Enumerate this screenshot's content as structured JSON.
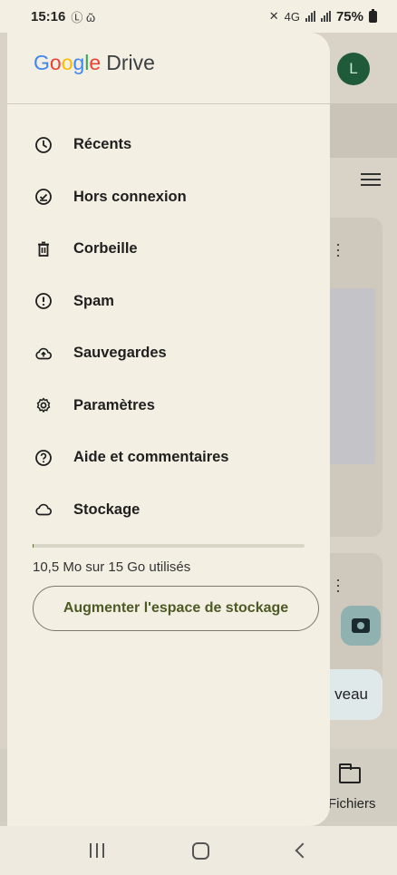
{
  "status_bar": {
    "time": "15:16",
    "indicators_left": "Ⓛ ῶ",
    "network": "4G",
    "battery": "75%"
  },
  "app": {
    "logo_google": [
      "G",
      "o",
      "o",
      "g",
      "l",
      "e"
    ],
    "logo_drive": "Drive"
  },
  "menu": [
    {
      "label": "Récents",
      "icon": "clock-icon"
    },
    {
      "label": "Hors connexion",
      "icon": "offline-check-icon"
    },
    {
      "label": "Corbeille",
      "icon": "trash-icon"
    },
    {
      "label": "Spam",
      "icon": "spam-icon"
    },
    {
      "label": "Sauvegardes",
      "icon": "cloud-upload-icon"
    },
    {
      "label": "Paramètres",
      "icon": "gear-icon"
    },
    {
      "label": "Aide et commentaires",
      "icon": "help-icon"
    },
    {
      "label": "Stockage",
      "icon": "cloud-icon"
    }
  ],
  "storage": {
    "usage_text": "10,5 Mo sur 15 Go utilisés",
    "used_fraction": 0.0007,
    "upgrade_label": "Augmenter l'espace de stockage"
  },
  "background": {
    "avatar_initial": "L",
    "new_button_partial": "veau",
    "files_tab_partial": "Fichiers"
  },
  "colors": {
    "drawer_bg": "#f4efe3",
    "accent_green": "#4d5a25",
    "avatar_bg": "#1f5a3a"
  }
}
